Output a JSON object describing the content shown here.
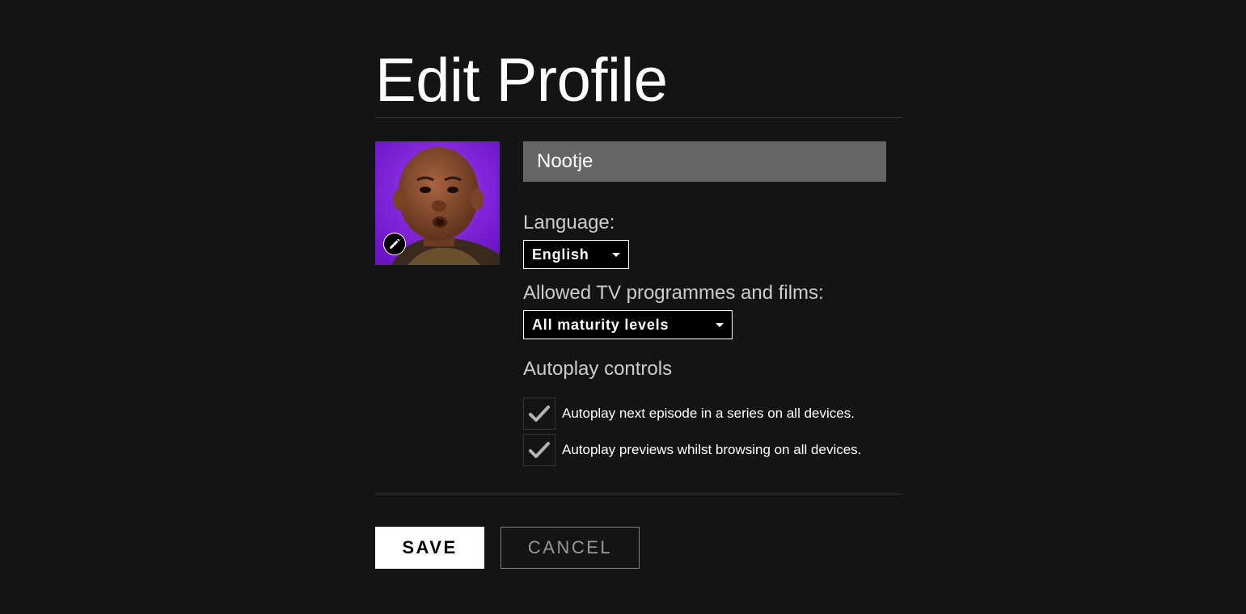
{
  "page": {
    "title": "Edit Profile"
  },
  "profile": {
    "name_value": "Nootje",
    "avatar_icon": "profile-avatar-image",
    "edit_icon": "pencil-icon"
  },
  "language": {
    "label": "Language:",
    "selected": "English"
  },
  "maturity": {
    "label": "Allowed TV programmes and films:",
    "selected": "All maturity levels"
  },
  "autoplay": {
    "heading": "Autoplay controls",
    "options": [
      {
        "label": "Autoplay next episode in a series on all devices.",
        "checked": true
      },
      {
        "label": "Autoplay previews whilst browsing on all devices.",
        "checked": true
      }
    ]
  },
  "actions": {
    "save_label": "SAVE",
    "cancel_label": "CANCEL"
  },
  "colors": {
    "background": "#141414",
    "input_bg": "#666666",
    "avatar_bg": "#7b1fd3",
    "muted_text": "#cccccc"
  }
}
